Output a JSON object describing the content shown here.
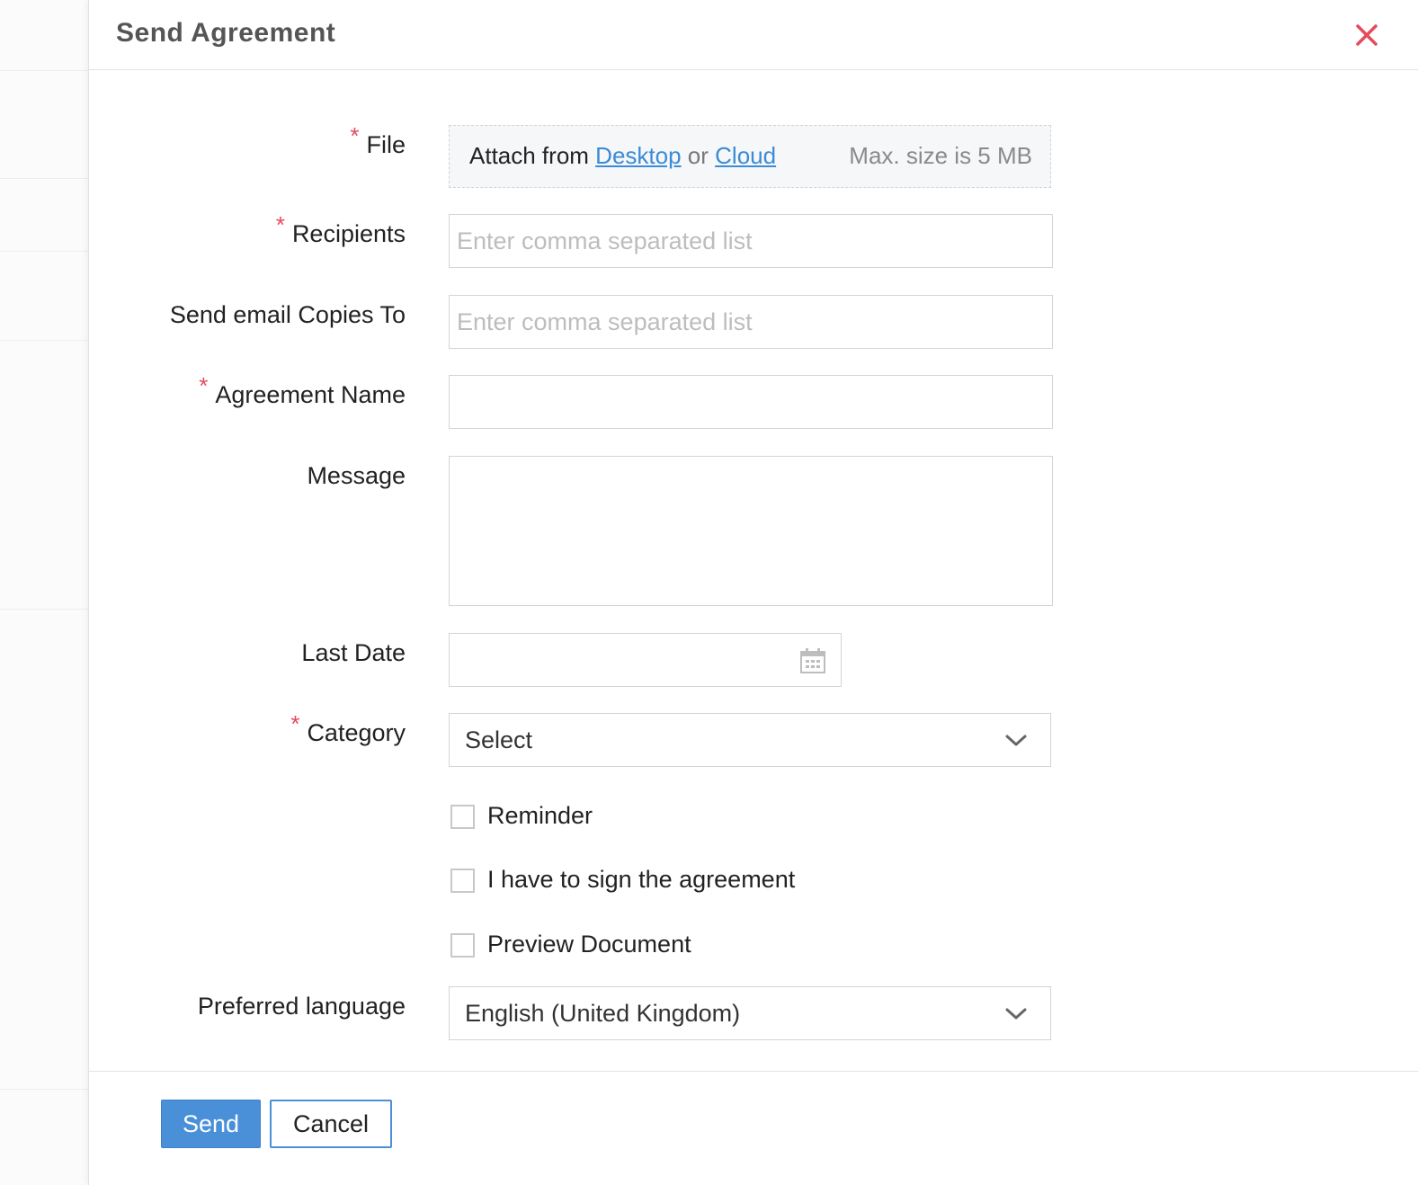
{
  "dialog": {
    "title": "Send Agreement",
    "close_icon": "close-icon",
    "accent_color": "#e54b5b"
  },
  "form": {
    "required_marker": "*",
    "file": {
      "label": "File",
      "attach_prefix": "Attach from",
      "desktop_link": "Desktop",
      "or_text": "or",
      "cloud_link": "Cloud",
      "max_size": "Max. size is 5 MB"
    },
    "recipients": {
      "label": "Recipients",
      "placeholder": "Enter comma separated list",
      "value": ""
    },
    "copies": {
      "label": "Send email Copies To",
      "placeholder": "Enter comma separated list",
      "value": ""
    },
    "agreement_name": {
      "label": "Agreement Name",
      "value": ""
    },
    "message": {
      "label": "Message",
      "value": ""
    },
    "last_date": {
      "label": "Last Date",
      "value": "",
      "icon": "calendar-icon"
    },
    "category": {
      "label": "Category",
      "selected": "Select"
    },
    "checkboxes": {
      "reminder": {
        "label": "Reminder",
        "checked": false
      },
      "self_sign": {
        "label": "I have to sign the agreement",
        "checked": false
      },
      "preview": {
        "label": "Preview Document",
        "checked": false
      }
    },
    "language": {
      "label": "Preferred language",
      "selected": "English (United Kingdom)"
    }
  },
  "footer": {
    "send_label": "Send",
    "cancel_label": "Cancel",
    "primary_color": "#4a90d9"
  }
}
